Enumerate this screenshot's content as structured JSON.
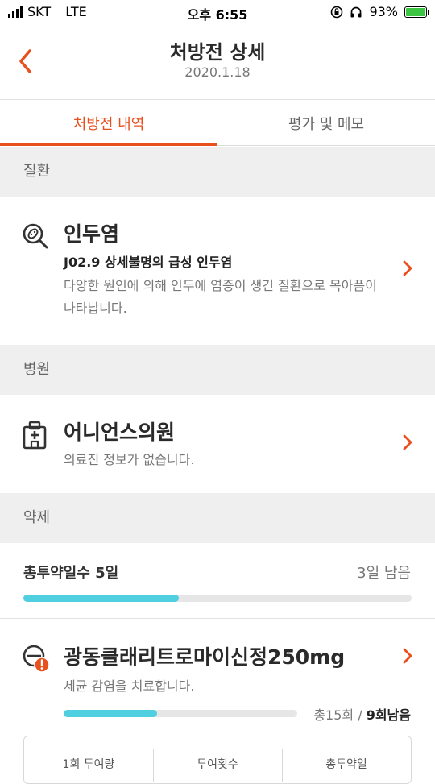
{
  "status_bar": {
    "carrier": "SKT",
    "network": "LTE",
    "time": "오후 6:55",
    "battery": "93%"
  },
  "header": {
    "title": "처방전 상세",
    "date": "2020.1.18"
  },
  "tabs": [
    {
      "label": "처방전 내역"
    },
    {
      "label": "평가 및 메모"
    }
  ],
  "disease": {
    "section_label": "질환",
    "name": "인두염",
    "code": "J02.9 상세불명의 급성 인두염",
    "description": "다양한 원인에 의해 인두에 염증이 생긴 질환으로 목아픔이 나타납니다."
  },
  "hospital": {
    "section_label": "병원",
    "name": "어니언스의원",
    "info": "의료진 정보가 없습니다."
  },
  "medicine": {
    "section_label": "약제",
    "total_days_label": "총투약일수 5일",
    "remaining_days": "3일 남음",
    "days_progress": 0.4,
    "drug": {
      "name": "광동클래리트로마이신정250mg",
      "description": "세균 감염을 치료합니다.",
      "count_total": "총15회",
      "count_sep": " / ",
      "count_remaining": "9회남음",
      "dose_progress": 0.4,
      "columns": [
        "1회 투여량",
        "투여횟수",
        "총투약일"
      ]
    }
  },
  "colors": {
    "accent": "#e8501e",
    "progress": "#4fcfe0",
    "section_bg": "#efefef"
  },
  "icons": {
    "back": "chevron-left-icon",
    "disease": "virus-search-icon",
    "hospital": "hospital-building-icon",
    "drug": "pill-alert-icon",
    "row": "chevron-right-icon"
  }
}
